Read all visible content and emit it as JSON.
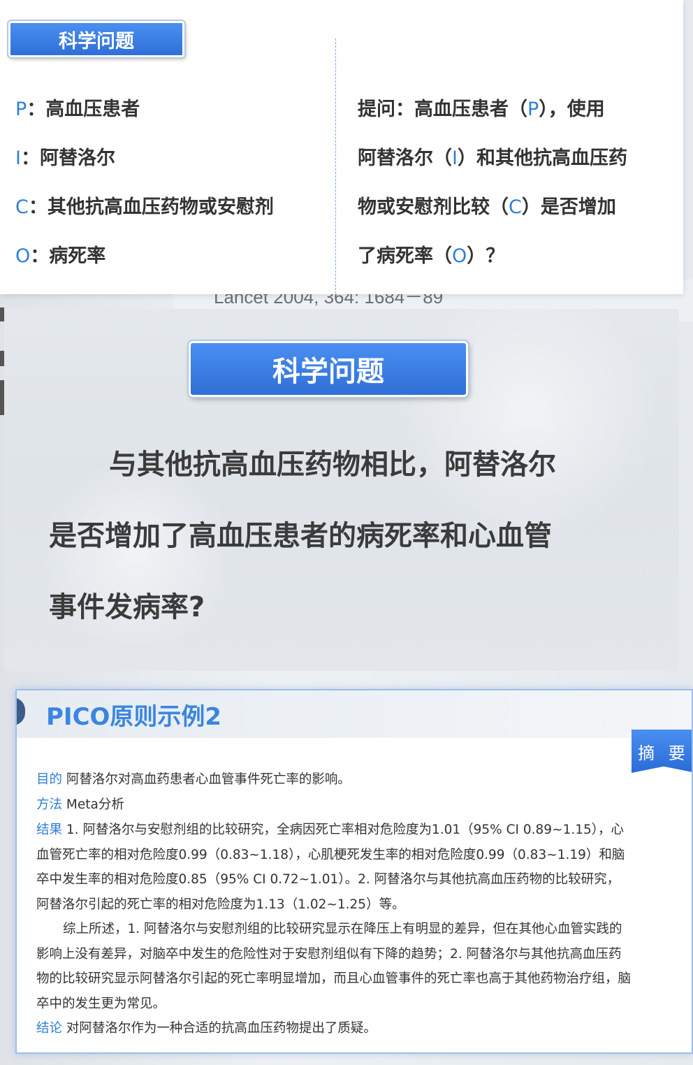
{
  "background": {
    "citation_fragment": "Lancet 2004, 364: 1684－89"
  },
  "slide1": {
    "pill_label": "科学问题",
    "pico": [
      {
        "letter": "P",
        "colon": "：",
        "text": "高血压患者"
      },
      {
        "letter": "I",
        "colon": "：",
        "text": "阿替洛尔"
      },
      {
        "letter": "C",
        "colon": "：",
        "text": "其他抗高血压药物或安慰剂"
      },
      {
        "letter": "O",
        "colon": "：",
        "text": "病死率"
      }
    ],
    "question_lines": [
      {
        "a": "提问：高血压患者（",
        "hl": "P",
        "b": "），使用"
      },
      {
        "a": "阿替洛尔（",
        "hl": "I",
        "b": "）和其他抗高血压药"
      },
      {
        "a": "物或安慰剂比较（",
        "hl": "C",
        "b": "）是否增加"
      },
      {
        "a": "了病死率（",
        "hl": "O",
        "b": "）？"
      }
    ]
  },
  "slide2": {
    "pill_label": "科学问题",
    "lines": [
      "与其他抗高血压药物相比，阿替洛尔",
      "是否增加了高血压患者的病死率和心血管",
      "事件发病率?"
    ]
  },
  "slide3": {
    "title": "PICO原则示例2",
    "badge": "摘 要",
    "purpose_label": "目的",
    "purpose_text": "阿替洛尔对高血药患者心血管事件死亡率的影响。",
    "method_label": "方法",
    "method_text": "Meta分析",
    "result_label": "结果",
    "result_lines": [
      "1. 阿替洛尔与安慰剂组的比较研究，全病因死亡率相对危险度为1.01（95% CI 0.89~1.15），心",
      "血管死亡率的相对危险度0.99（0.83~1.18），心肌梗死发生率的相对危险度0.99（0.83~1.19）和脑",
      "卒中发生率的相对危险度0.85（95% CI 0.72~1.01）。2. 阿替洛尔与其他抗高血压药物的比较研究，",
      "阿替洛尔引起的死亡率的相对危险度为1.13（1.02~1.25）等。"
    ],
    "summary_lines": [
      "综上所述，1. 阿替洛尔与安慰剂组的比较研究显示在降压上有明显的差异，但在其他心血管实践的",
      "影响上没有差异，对脑卒中发生的危险性对于安慰剂组似有下降的趋势；2. 阿替洛尔与其他抗高血压药",
      "物的比较研究显示阿替洛尔引起的死亡率明显增加，而且心血管事件的死亡率也高于其他药物治疗组，脑",
      "卒中的发生更为常见。"
    ],
    "conclusion_label": "结论",
    "conclusion_text": "对阿替洛尔作为一种合适的抗高血压药物提出了质疑。"
  }
}
